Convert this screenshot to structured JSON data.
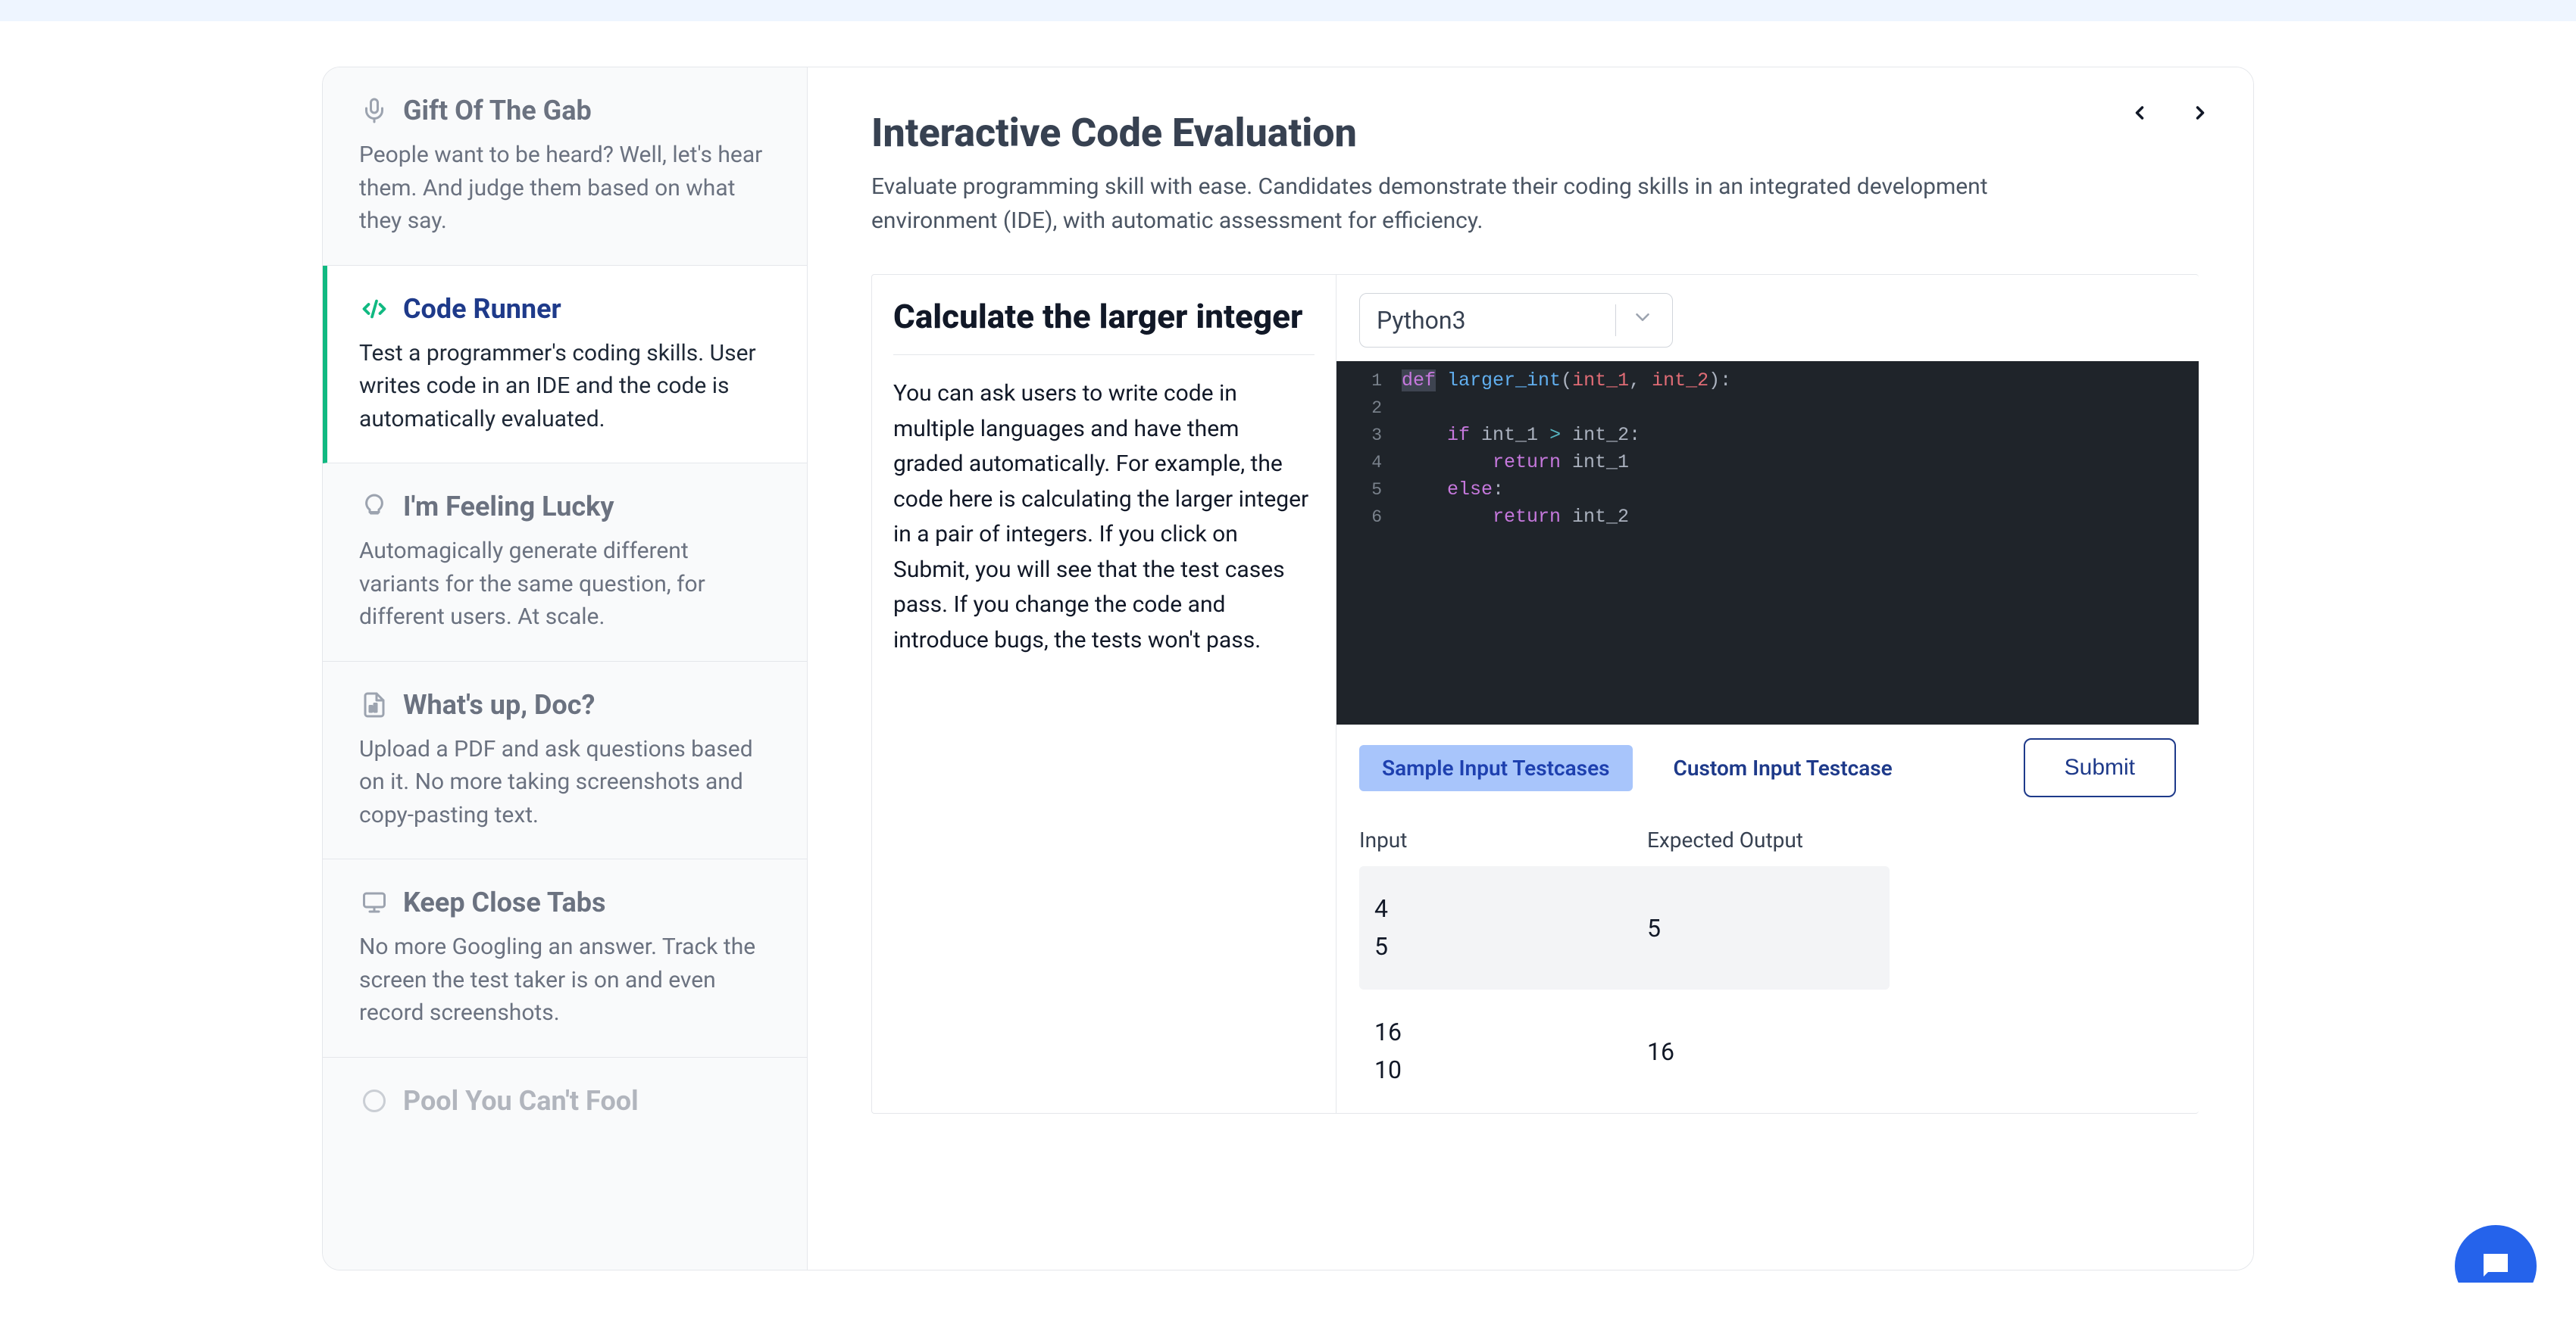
{
  "sidebar": {
    "items": [
      {
        "title": "Gift Of The Gab",
        "desc": "People want to be heard? Well, let's hear them. And judge them based on what they say.",
        "icon": "mic-icon"
      },
      {
        "title": "Code Runner",
        "desc": "Test a programmer's coding skills. User writes code in an IDE and the code is automatically evaluated.",
        "icon": "code-icon",
        "active": true
      },
      {
        "title": "I'm Feeling Lucky",
        "desc": "Automagically generate different variants for the same question, for different users. At scale.",
        "icon": "bulb-icon"
      },
      {
        "title": "What's up, Doc?",
        "desc": "Upload a PDF and ask questions based on it. No more taking screenshots and copy-pasting text.",
        "icon": "doc-icon"
      },
      {
        "title": "Keep Close Tabs",
        "desc": "No more Googling an answer. Track the screen the test taker is on and even record screenshots.",
        "icon": "monitor-icon"
      },
      {
        "title": "Pool You Can't Fool",
        "desc": "",
        "icon": "pool-icon"
      }
    ]
  },
  "main": {
    "heading": "Interactive Code Evaluation",
    "subtitle": "Evaluate programming skill with ease. Candidates demonstrate their coding skills in an integrated development environment (IDE), with automatic assessment for efficiency.",
    "problem_title": "Calculate the larger integer",
    "problem_desc": "You can ask users to write code in multiple languages and have them graded automatically. For example, the code here is calculating the larger integer in a pair of integers. If you click on Submit, you will see that the test cases pass. If you change the code and introduce bugs, the tests won't pass.",
    "language": "Python3",
    "code_lines": [
      {
        "n": 1,
        "html": "<span class='sel-bg'><span class='tok-kw'>def</span></span><span class='tok-pl'> </span><span class='tok-fn'>larger_int</span><span class='tok-pl'>(</span><span class='tok-var'>int_1</span><span class='tok-pl'>, </span><span class='tok-var'>int_2</span><span class='tok-pl'>):</span>"
      },
      {
        "n": 2,
        "html": ""
      },
      {
        "n": 3,
        "html": "    <span class='tok-kw'>if</span><span class='tok-pl'> int_1 </span><span class='tok-op'>></span><span class='tok-pl'> int_2:</span>"
      },
      {
        "n": 4,
        "html": "        <span class='tok-kw'>return</span><span class='tok-pl'> int_1</span>"
      },
      {
        "n": 5,
        "html": "    <span class='tok-kw'>else</span><span class='tok-pl'>:</span>"
      },
      {
        "n": 6,
        "html": "        <span class='tok-kw'>return</span><span class='tok-pl'> int_2</span>"
      }
    ],
    "tabs": {
      "sample": "Sample Input Testcases",
      "custom": "Custom Input Testcase"
    },
    "submit_label": "Submit",
    "results": {
      "head_input": "Input",
      "head_expected": "Expected Output",
      "rows": [
        {
          "input": "4\n5",
          "expected": "5"
        },
        {
          "input": "16\n10",
          "expected": "16"
        }
      ]
    }
  }
}
